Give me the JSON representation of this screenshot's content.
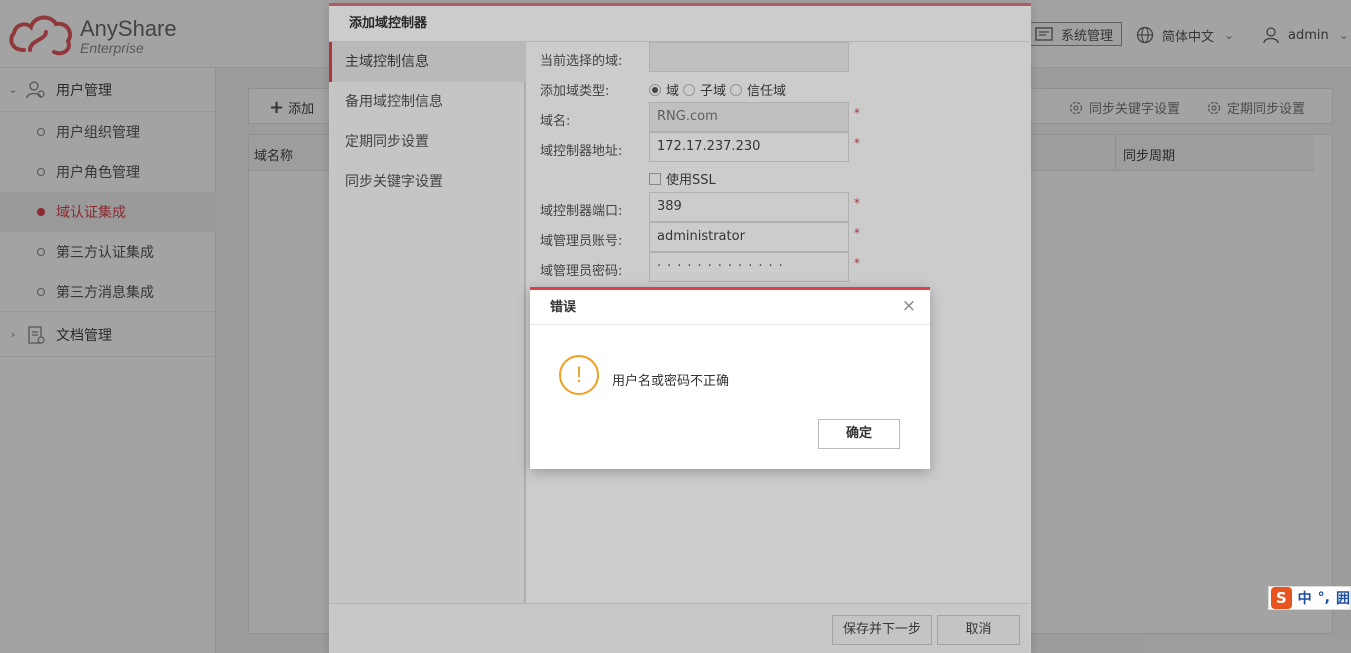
{
  "header": {
    "logo_name": "AnyShare",
    "logo_edition": "Enterprise",
    "system_label": "系统管理",
    "language_label": "简体中文",
    "user_label": "admin"
  },
  "sidebar": {
    "groups": [
      {
        "label": "用户管理"
      },
      {
        "label": "文档管理"
      }
    ],
    "items": [
      {
        "label": "用户组织管理"
      },
      {
        "label": "用户角色管理"
      },
      {
        "label": "域认证集成"
      },
      {
        "label": "第三方认证集成"
      },
      {
        "label": "第三方消息集成"
      }
    ]
  },
  "toolbar": {
    "add_label": "添加",
    "sync_keyword_label": "同步关键字设置",
    "sync_schedule_label": "定期同步设置"
  },
  "table": {
    "columns": [
      "域名称",
      "同步周期"
    ]
  },
  "modal": {
    "title": "添加域控制器",
    "tabs": [
      {
        "label": "主域控制信息"
      },
      {
        "label": "备用域控制信息"
      },
      {
        "label": "定期同步设置"
      },
      {
        "label": "同步关键字设置"
      }
    ],
    "fields": {
      "current_domain_label": "当前选择的域:",
      "current_domain_value": "",
      "domain_type_label": "添加域类型:",
      "domain_type_options": [
        "域",
        "子域",
        "信任域"
      ],
      "domain_type_selected": "域",
      "domain_name_label": "域名:",
      "domain_name_value": "RNG.com",
      "controller_address_label": "域控制器地址:",
      "controller_address_value": "172.17.237.230",
      "ssl_label": "使用SSL",
      "ssl_checked": false,
      "controller_port_label": "域控制器端口:",
      "controller_port_value": "389",
      "admin_account_label": "域管理员账号:",
      "admin_account_value": "administrator",
      "admin_password_label": "域管理员密码:",
      "admin_password_masked": "·············",
      "required_mark": "*"
    },
    "save_next_label": "保存并下一步",
    "cancel_label": "取消"
  },
  "error_dialog": {
    "title": "错误",
    "close_glyph": "×",
    "icon_glyph": "!",
    "message": "用户名或密码不正确",
    "ok_label": "确定"
  },
  "ime": {
    "logo": "S",
    "mode": "中",
    "punct": "°,",
    "extra": "囲"
  },
  "colors": {
    "accent": "#d9444a",
    "warning": "#f0a020"
  }
}
